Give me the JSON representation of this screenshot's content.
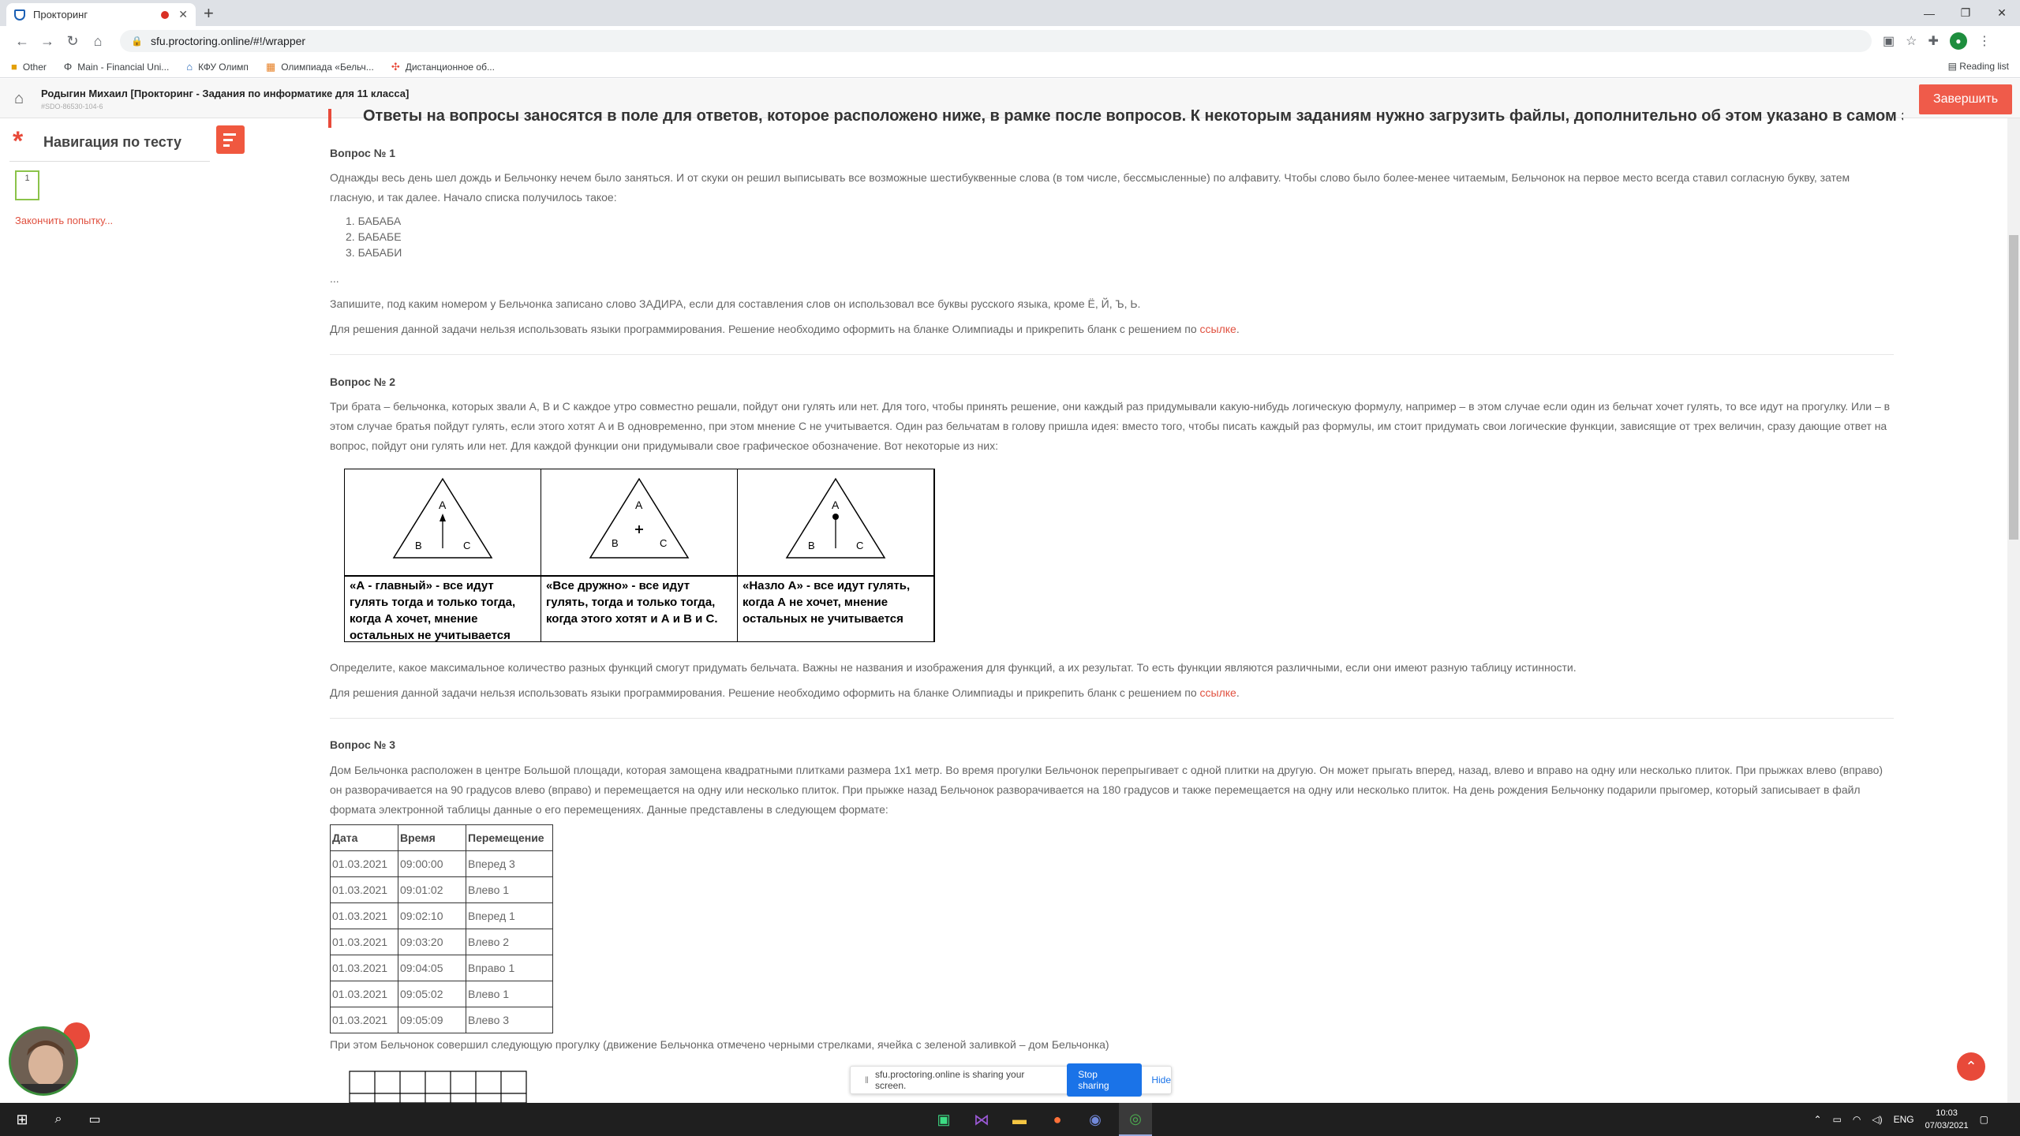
{
  "browser": {
    "tab_title": "Прокторинг",
    "url": "sfu.proctoring.online/#!/wrapper",
    "bookmarks": [
      "Other",
      "Main - Financial Uni...",
      "КФУ Олимп",
      "Олимпиада «Бельч...",
      "Дистанционное об..."
    ],
    "reading_list": "Reading list"
  },
  "header": {
    "user_line": "Родыгин Михаил [Прокторинг - Задания по информатике для 11 класса]",
    "user_id": "#SDO-86530-104-6",
    "finish_label": "Завершить"
  },
  "sidebar": {
    "title": "Навигация по тесту",
    "question_number": "1",
    "end_attempt": "Закончить попытку..."
  },
  "main": {
    "banner_text": "Ответы на вопросы заносятся в поле для ответов, которое расположено ниже, в рамке после вопросов. К некоторым заданиям нужно загрузить файлы, дополнительно об этом указано в самом задании.",
    "q1": {
      "title": "Вопрос № 1",
      "text": "Однажды весь день шел дождь и Бельчонку нечем было заняться. И от скуки он решил выписывать все возможные шестибуквенные слова (в том числе, бессмысленные) по алфавиту. Чтобы слово было более-менее читаемым, Бельчонок на первое место всегда ставил согласную букву, затем гласную, и так далее. Начало списка получилось такое:",
      "list": [
        "БАБАБА",
        "БАБАБЕ",
        "БАБАБИ"
      ],
      "ellipsis": "...",
      "task": "Запишите, под каким номером у Бельчонка записано слово ЗАДИРА, если для составления слов он использовал все буквы русского языка, кроме Ё, Й, Ъ, Ь.",
      "note": "Для решения данной задачи нельзя использовать языки программирования. Решение необходимо оформить на бланке Олимпиады и прикрепить бланк с решением по ",
      "link": "ссылке"
    },
    "q2": {
      "title": "Вопрос № 2",
      "text": "Три брата – бельчонка, которых звали A, B и C каждое утро совместно решали, пойдут они гулять или нет. Для того, чтобы принять решение, они каждый раз придумывали какую-нибудь логическую формулу, например  – в этом случае если один из бельчат хочет гулять, то все идут на прогулку. Или  – в этом случае братья пойдут гулять, если этого хотят A и B одновременно, при этом мнение C не учитывается. Один раз бельчатам в голову пришла идея: вместо того, чтобы писать каждый раз формулы, им стоит придумать свои логические функции, зависящие от трех величин, сразу дающие ответ на вопрос, пойдут они гулять или нет. Для каждой функции они придумывали свое графическое обозначение. Вот некоторые из них:",
      "figures": [
        {
          "label_a": "A",
          "label_b": "B",
          "label_c": "C",
          "caption": "«А - главный» - все идут гулять тогда и только тогда, когда А хочет, мнение остальных не учитывается"
        },
        {
          "label_a": "A",
          "label_b": "B",
          "label_c": "C",
          "caption": "«Все дружно» - все идут гулять, тогда и только тогда, когда этого хотят и А и В и С."
        },
        {
          "label_a": "A",
          "label_b": "B",
          "label_c": "C",
          "caption": "«Назло А» - все идут гулять, когда А не хочет, мнение остальных не учитывается"
        }
      ],
      "task": "Определите, какое максимальное количество разных функций смогут придумать бельчата. Важны не названия и изображения для функций, а их результат. То есть функции являются различными, если они имеют разную таблицу истинности.",
      "note": "Для решения данной задачи нельзя использовать языки программирования. Решение необходимо оформить на бланке Олимпиады и прикрепить бланк с решением по ",
      "link": "ссылке"
    },
    "q3": {
      "title": "Вопрос № 3",
      "text": "Дом Бельчонка расположен в центре Большой площади, которая замощена квадратными плитками размера 1x1 метр. Во время прогулки Бельчонок перепрыгивает с одной плитки на другую. Он может прыгать вперед, назад, влево и вправо на одну или несколько плиток. При прыжках влево (вправо) он разворачивается на 90 градусов влево (вправо) и перемещается на одну или несколько плиток. При прыжке назад Бельчонок разворачивается на 180 градусов и также перемещается на одну или несколько плиток. На день рождения Бельчонку подарили прыгомер, который записывает в файл формата электронной таблицы данные о его перемещениях. Данные представлены в следующем формате:",
      "table_headers": [
        "Дата",
        "Время",
        "Перемещение"
      ],
      "table_rows": [
        [
          "01.03.2021",
          "09:00:00",
          "Вперед 3"
        ],
        [
          "01.03.2021",
          "09:01:02",
          "Влево 1"
        ],
        [
          "01.03.2021",
          "09:02:10",
          "Вперед 1"
        ],
        [
          "01.03.2021",
          "09:03:20",
          "Влево 2"
        ],
        [
          "01.03.2021",
          "09:04:05",
          "Вправо 1"
        ],
        [
          "01.03.2021",
          "09:05:02",
          "Влево 1"
        ],
        [
          "01.03.2021",
          "09:05:09",
          "Влево 3"
        ]
      ],
      "after_table": "При этом Бельчонок совершил следующую прогулку (движение Бельчонка отмечено черными стрелками, ячейка с зеленой заливкой – дом Бельчонка)"
    }
  },
  "share_bar": {
    "text": "sfu.proctoring.online is sharing your screen.",
    "stop_label": "Stop sharing",
    "hide_label": "Hide"
  },
  "taskbar": {
    "lang": "ENG",
    "time": "10:03",
    "date": "07/03/2021"
  },
  "colors": {
    "accent": "#ef5b4a",
    "link": "#e0503f",
    "qbox_border": "#8bc34a"
  }
}
